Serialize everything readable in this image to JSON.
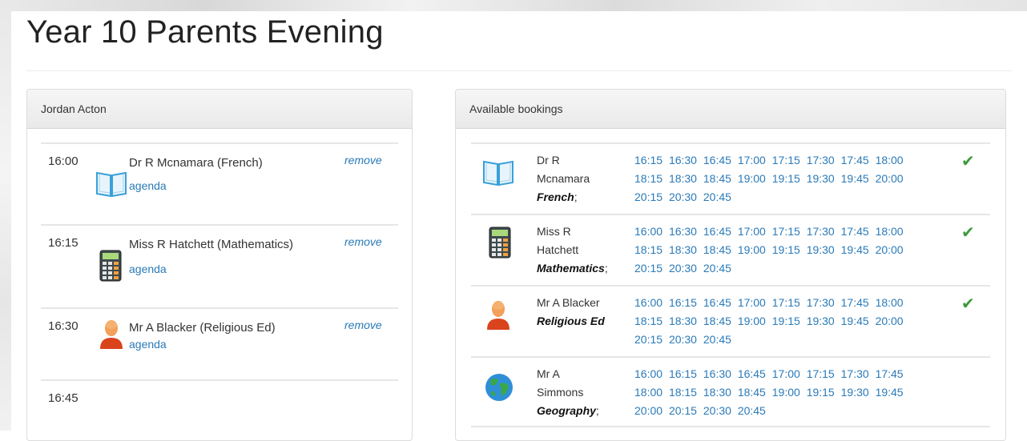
{
  "page": {
    "title": "Year 10 Parents Evening"
  },
  "student_panel": {
    "heading": "Jordan Acton",
    "rows": [
      {
        "time": "16:00",
        "teacher": "Dr R Mcnamara (French)",
        "agenda_label": "agenda",
        "remove_label": "remove",
        "icon": "book-icon"
      },
      {
        "time": "16:15",
        "teacher": "Miss R Hatchett (Mathematics)",
        "agenda_label": "agenda",
        "remove_label": "remove",
        "icon": "calculator-icon"
      },
      {
        "time": "16:30",
        "teacher": "Mr A Blacker (Religious Ed)",
        "agenda_label": "agenda",
        "remove_label": "remove",
        "icon": "person-icon"
      },
      {
        "time": "16:45"
      }
    ]
  },
  "bookings_panel": {
    "heading": "Available bookings",
    "rows": [
      {
        "teacher_lines": [
          "Dr R",
          "Mcnamara"
        ],
        "subject": "French",
        "subject_suffix": ";",
        "icon": "book-icon",
        "booked": true,
        "slots": [
          "16:15",
          "16:30",
          "16:45",
          "17:00",
          "17:15",
          "17:30",
          "17:45",
          "18:00",
          "18:15",
          "18:30",
          "18:45",
          "19:00",
          "19:15",
          "19:30",
          "19:45",
          "20:00",
          "20:15",
          "20:30",
          "20:45"
        ]
      },
      {
        "teacher_lines": [
          "Miss R",
          "Hatchett"
        ],
        "subject": "Mathematics",
        "subject_suffix": ";",
        "icon": "calculator-icon",
        "booked": true,
        "slots": [
          "16:00",
          "16:30",
          "16:45",
          "17:00",
          "17:15",
          "17:30",
          "17:45",
          "18:00",
          "18:15",
          "18:30",
          "18:45",
          "19:00",
          "19:15",
          "19:30",
          "19:45",
          "20:00",
          "20:15",
          "20:30",
          "20:45"
        ]
      },
      {
        "teacher_lines": [
          "Mr A Blacker"
        ],
        "subject": "Religious Ed",
        "subject_suffix": "",
        "icon": "person-icon",
        "booked": true,
        "slots": [
          "16:00",
          "16:15",
          "16:45",
          "17:00",
          "17:15",
          "17:30",
          "17:45",
          "18:00",
          "18:15",
          "18:30",
          "18:45",
          "19:00",
          "19:15",
          "19:30",
          "19:45",
          "20:00",
          "20:15",
          "20:30",
          "20:45"
        ]
      },
      {
        "teacher_lines": [
          "Mr A",
          "Simmons"
        ],
        "subject": "Geography",
        "subject_suffix": ";",
        "icon": "globe-icon",
        "booked": false,
        "slots": [
          "16:00",
          "16:15",
          "16:30",
          "16:45",
          "17:00",
          "17:15",
          "17:30",
          "17:45",
          "18:00",
          "18:15",
          "18:30",
          "18:45",
          "19:00",
          "19:15",
          "19:30",
          "19:45",
          "20:00",
          "20:15",
          "20:30",
          "20:45"
        ]
      }
    ],
    "check_glyph": "✔"
  }
}
